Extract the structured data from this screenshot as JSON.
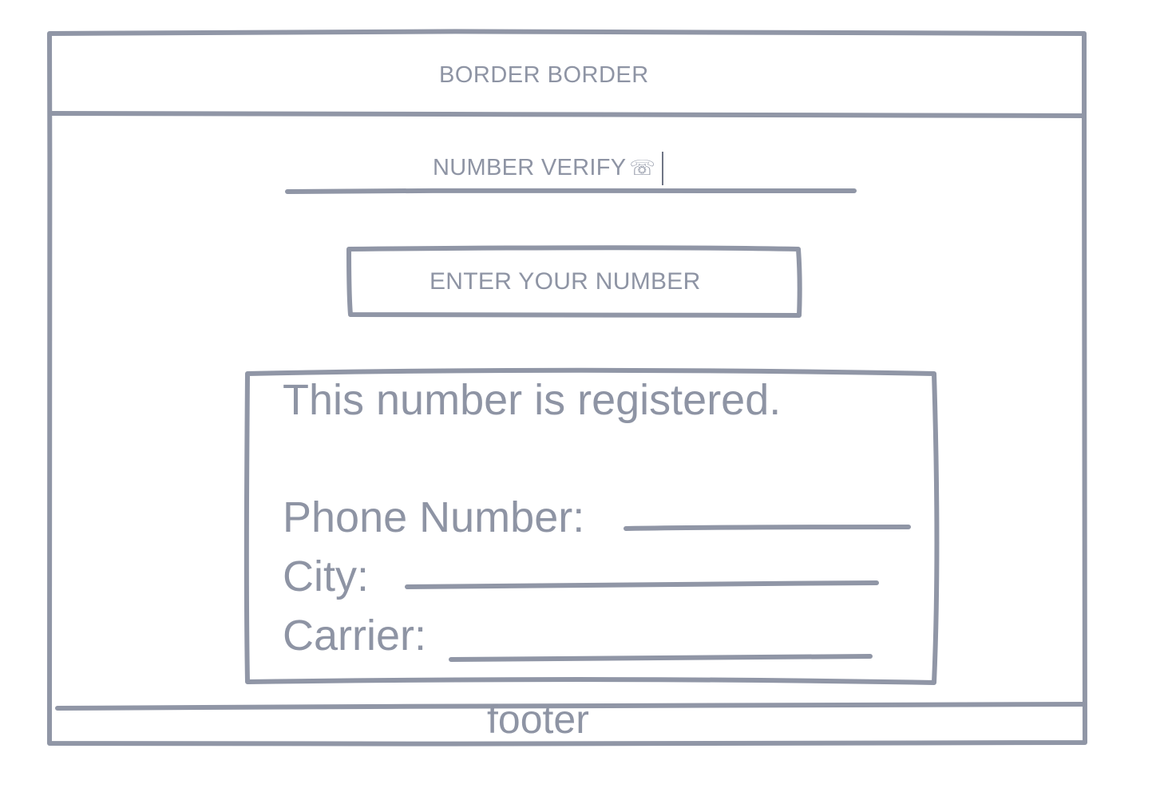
{
  "header": {
    "title": "BORDER  BORDER"
  },
  "verify": {
    "label": "NUMBER VERIFY",
    "icon": "telephone-icon",
    "icon_glyph": "☏"
  },
  "button": {
    "label": "ENTER YOUR NUMBER"
  },
  "result": {
    "message": "This number is registered.",
    "fields": [
      {
        "label": "Phone Number:",
        "value": ""
      },
      {
        "label": "City:",
        "value": ""
      },
      {
        "label": "Carrier:",
        "value": ""
      }
    ]
  },
  "footer": {
    "text": "footer"
  },
  "colors": {
    "stroke": "#9096a6",
    "text": "#8e94a4"
  }
}
